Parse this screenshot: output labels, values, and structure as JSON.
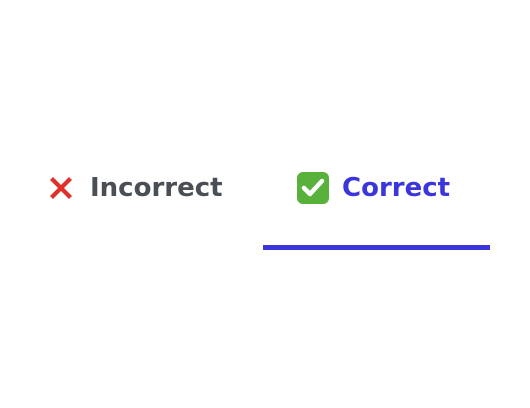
{
  "tabs": [
    {
      "label": "Incorrect",
      "icon": "cross-mark-icon",
      "active": false
    },
    {
      "label": "Correct",
      "icon": "check-mark-button-icon",
      "active": true
    }
  ],
  "colors": {
    "active": "#3a36dc",
    "inactive": "#4a4e55",
    "cross": "#e0302a",
    "check": "#57b13b"
  }
}
